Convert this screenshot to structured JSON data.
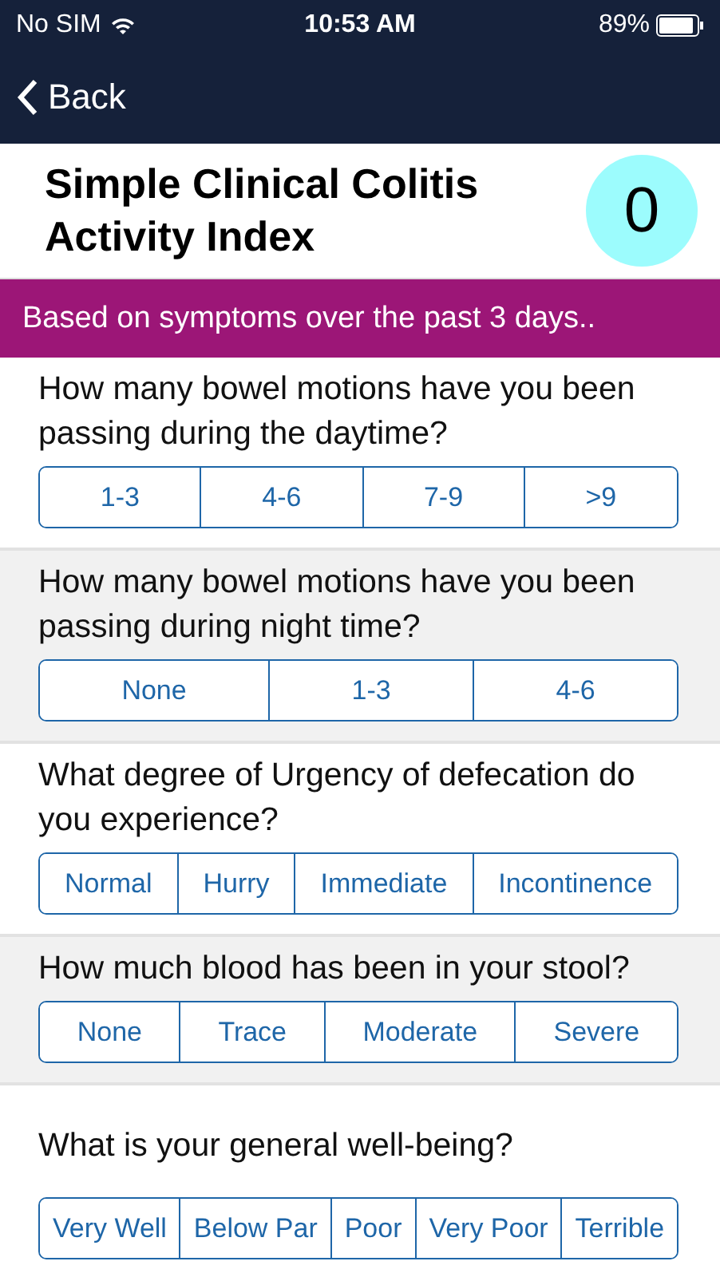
{
  "status_bar": {
    "carrier": "No SIM",
    "time": "10:53 AM",
    "battery": "89%"
  },
  "nav_bar": {
    "back": "Back"
  },
  "header": {
    "title": "Simple Clinical Colitis Activity Index",
    "score": "0"
  },
  "banner": "Based on symptoms over the past 3 days..",
  "questions": [
    {
      "text": "How many bowel motions have you been passing during the daytime?",
      "options": [
        {
          "label": "1-3",
          "selected": false
        },
        {
          "label": "4-6",
          "selected": false
        },
        {
          "label": "7-9",
          "selected": false
        },
        {
          "label": ">9",
          "selected": false
        }
      ]
    },
    {
      "text": "How many bowel motions have you been passing during night time?",
      "options": [
        {
          "label": "None",
          "selected": false
        },
        {
          "label": "1-3",
          "selected": false
        },
        {
          "label": "4-6",
          "selected": false
        }
      ]
    },
    {
      "text": "What degree of Urgency of defecation do you experience?",
      "options": [
        {
          "label": "Normal",
          "selected": false
        },
        {
          "label": "Hurry",
          "selected": false
        },
        {
          "label": "Immediate",
          "selected": false
        },
        {
          "label": "Incontinence",
          "selected": false
        }
      ]
    },
    {
      "text": "How much blood has been in your stool?",
      "options": [
        {
          "label": "None",
          "selected": false
        },
        {
          "label": "Trace",
          "selected": false
        },
        {
          "label": "Moderate",
          "selected": false
        },
        {
          "label": "Severe",
          "selected": false
        }
      ]
    },
    {
      "text": "What is your general well-being?",
      "options": [
        {
          "label": "Very Well",
          "selected": false
        },
        {
          "label": "Below Par",
          "selected": false
        },
        {
          "label": "Poor",
          "selected": false
        },
        {
          "label": "Very Poor",
          "selected": false
        },
        {
          "label": "Terrible",
          "selected": false
        }
      ]
    }
  ]
}
